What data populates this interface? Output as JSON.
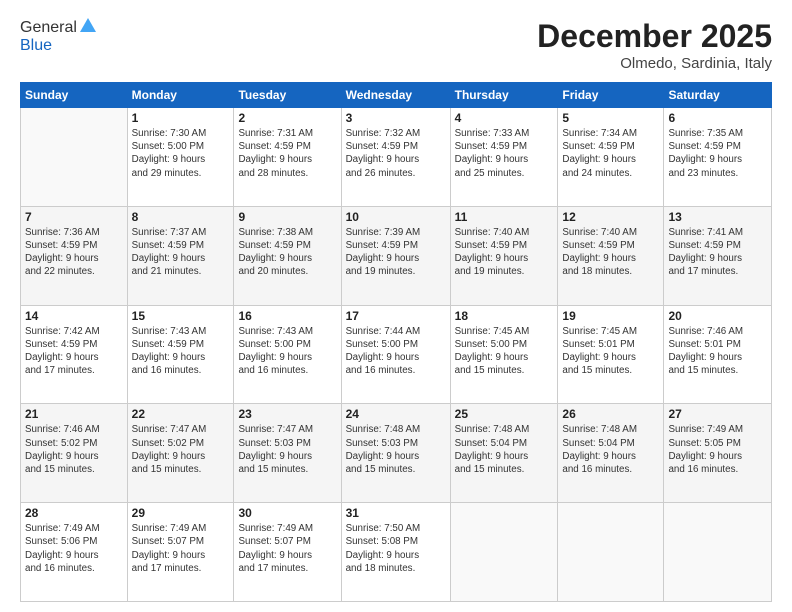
{
  "header": {
    "logo_general": "General",
    "logo_blue": "Blue",
    "month_title": "December 2025",
    "location": "Olmedo, Sardinia, Italy"
  },
  "weekdays": [
    "Sunday",
    "Monday",
    "Tuesday",
    "Wednesday",
    "Thursday",
    "Friday",
    "Saturday"
  ],
  "weeks": [
    [
      {
        "day": "",
        "info": ""
      },
      {
        "day": "1",
        "info": "Sunrise: 7:30 AM\nSunset: 5:00 PM\nDaylight: 9 hours\nand 29 minutes."
      },
      {
        "day": "2",
        "info": "Sunrise: 7:31 AM\nSunset: 4:59 PM\nDaylight: 9 hours\nand 28 minutes."
      },
      {
        "day": "3",
        "info": "Sunrise: 7:32 AM\nSunset: 4:59 PM\nDaylight: 9 hours\nand 26 minutes."
      },
      {
        "day": "4",
        "info": "Sunrise: 7:33 AM\nSunset: 4:59 PM\nDaylight: 9 hours\nand 25 minutes."
      },
      {
        "day": "5",
        "info": "Sunrise: 7:34 AM\nSunset: 4:59 PM\nDaylight: 9 hours\nand 24 minutes."
      },
      {
        "day": "6",
        "info": "Sunrise: 7:35 AM\nSunset: 4:59 PM\nDaylight: 9 hours\nand 23 minutes."
      }
    ],
    [
      {
        "day": "7",
        "info": "Sunrise: 7:36 AM\nSunset: 4:59 PM\nDaylight: 9 hours\nand 22 minutes."
      },
      {
        "day": "8",
        "info": "Sunrise: 7:37 AM\nSunset: 4:59 PM\nDaylight: 9 hours\nand 21 minutes."
      },
      {
        "day": "9",
        "info": "Sunrise: 7:38 AM\nSunset: 4:59 PM\nDaylight: 9 hours\nand 20 minutes."
      },
      {
        "day": "10",
        "info": "Sunrise: 7:39 AM\nSunset: 4:59 PM\nDaylight: 9 hours\nand 19 minutes."
      },
      {
        "day": "11",
        "info": "Sunrise: 7:40 AM\nSunset: 4:59 PM\nDaylight: 9 hours\nand 19 minutes."
      },
      {
        "day": "12",
        "info": "Sunrise: 7:40 AM\nSunset: 4:59 PM\nDaylight: 9 hours\nand 18 minutes."
      },
      {
        "day": "13",
        "info": "Sunrise: 7:41 AM\nSunset: 4:59 PM\nDaylight: 9 hours\nand 17 minutes."
      }
    ],
    [
      {
        "day": "14",
        "info": "Sunrise: 7:42 AM\nSunset: 4:59 PM\nDaylight: 9 hours\nand 17 minutes."
      },
      {
        "day": "15",
        "info": "Sunrise: 7:43 AM\nSunset: 4:59 PM\nDaylight: 9 hours\nand 16 minutes."
      },
      {
        "day": "16",
        "info": "Sunrise: 7:43 AM\nSunset: 5:00 PM\nDaylight: 9 hours\nand 16 minutes."
      },
      {
        "day": "17",
        "info": "Sunrise: 7:44 AM\nSunset: 5:00 PM\nDaylight: 9 hours\nand 16 minutes."
      },
      {
        "day": "18",
        "info": "Sunrise: 7:45 AM\nSunset: 5:00 PM\nDaylight: 9 hours\nand 15 minutes."
      },
      {
        "day": "19",
        "info": "Sunrise: 7:45 AM\nSunset: 5:01 PM\nDaylight: 9 hours\nand 15 minutes."
      },
      {
        "day": "20",
        "info": "Sunrise: 7:46 AM\nSunset: 5:01 PM\nDaylight: 9 hours\nand 15 minutes."
      }
    ],
    [
      {
        "day": "21",
        "info": "Sunrise: 7:46 AM\nSunset: 5:02 PM\nDaylight: 9 hours\nand 15 minutes."
      },
      {
        "day": "22",
        "info": "Sunrise: 7:47 AM\nSunset: 5:02 PM\nDaylight: 9 hours\nand 15 minutes."
      },
      {
        "day": "23",
        "info": "Sunrise: 7:47 AM\nSunset: 5:03 PM\nDaylight: 9 hours\nand 15 minutes."
      },
      {
        "day": "24",
        "info": "Sunrise: 7:48 AM\nSunset: 5:03 PM\nDaylight: 9 hours\nand 15 minutes."
      },
      {
        "day": "25",
        "info": "Sunrise: 7:48 AM\nSunset: 5:04 PM\nDaylight: 9 hours\nand 15 minutes."
      },
      {
        "day": "26",
        "info": "Sunrise: 7:48 AM\nSunset: 5:04 PM\nDaylight: 9 hours\nand 16 minutes."
      },
      {
        "day": "27",
        "info": "Sunrise: 7:49 AM\nSunset: 5:05 PM\nDaylight: 9 hours\nand 16 minutes."
      }
    ],
    [
      {
        "day": "28",
        "info": "Sunrise: 7:49 AM\nSunset: 5:06 PM\nDaylight: 9 hours\nand 16 minutes."
      },
      {
        "day": "29",
        "info": "Sunrise: 7:49 AM\nSunset: 5:07 PM\nDaylight: 9 hours\nand 17 minutes."
      },
      {
        "day": "30",
        "info": "Sunrise: 7:49 AM\nSunset: 5:07 PM\nDaylight: 9 hours\nand 17 minutes."
      },
      {
        "day": "31",
        "info": "Sunrise: 7:50 AM\nSunset: 5:08 PM\nDaylight: 9 hours\nand 18 minutes."
      },
      {
        "day": "",
        "info": ""
      },
      {
        "day": "",
        "info": ""
      },
      {
        "day": "",
        "info": ""
      }
    ]
  ]
}
